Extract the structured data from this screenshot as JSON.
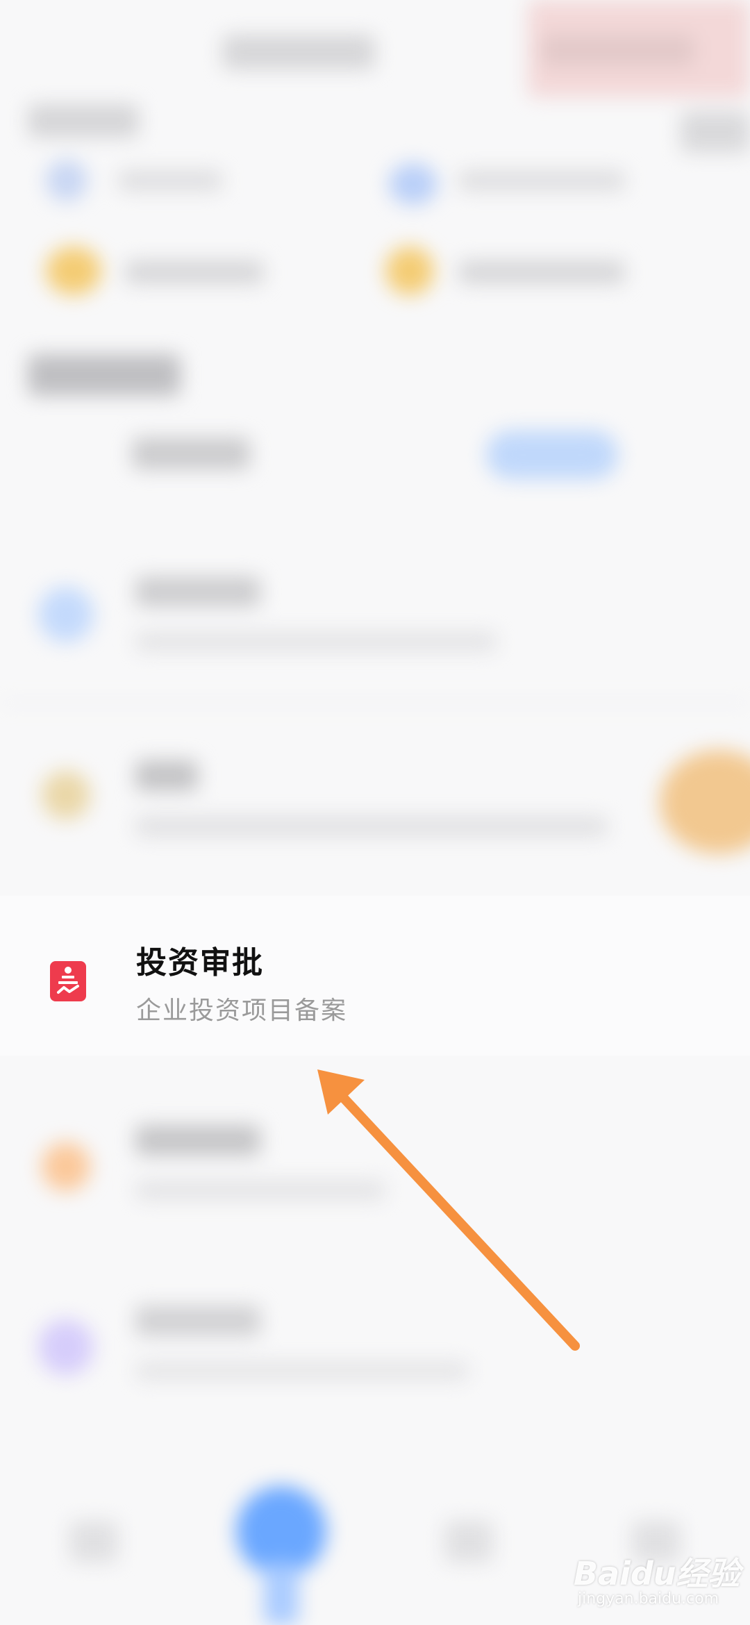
{
  "highlighted_item": {
    "title": "投资审批",
    "subtitle": "企业投资项目备案",
    "icon": "stamp-seal-icon",
    "icon_color": "#ee3b4d"
  },
  "annotation": {
    "arrow_color": "#f6913f"
  },
  "watermark": {
    "logo_text": "Baidu经验",
    "url": "jingyan.baidu.com"
  },
  "colors": {
    "background": "#f8f8f9",
    "title_text": "#111111",
    "subtitle_text": "#9a9a9a",
    "primary_blue": "#6aa7ff"
  }
}
